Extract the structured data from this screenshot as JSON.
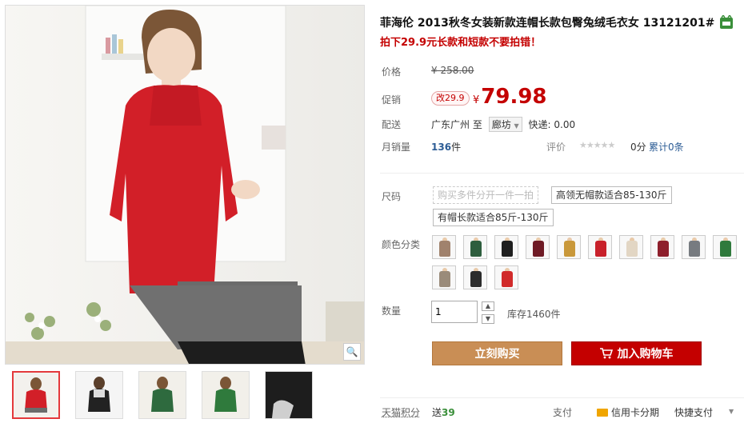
{
  "product": {
    "title": "菲海伦 2013秋冬女装新款连帽长款包臀兔绒毛衣女 13121201#",
    "promo": "拍下29.9元长款和短款不要拍错！"
  },
  "price": {
    "original_label": "价格",
    "original": "¥ 258.00",
    "promo_label": "促销",
    "badge": "改29.9",
    "currency": "¥",
    "current": "79.98"
  },
  "shipping": {
    "label": "配送",
    "from": "广东广州",
    "to_word": "至",
    "destination": "廊坊",
    "fee": "快递: 0.00"
  },
  "sales": {
    "label": "月销量",
    "count": "136",
    "unit": "件",
    "rating_label": "评价",
    "stars": "★★★★★",
    "score": "0分",
    "reviews": "累计0条"
  },
  "size": {
    "label": "尺码",
    "options": [
      "购买多件分开一件一拍",
      "高领无帽款适合85-130斤",
      "有帽长款适合85斤-130斤"
    ]
  },
  "color": {
    "label": "颜色分类",
    "swatches": [
      {
        "name": "camel",
        "color": "#a0826d"
      },
      {
        "name": "dark-green",
        "color": "#2e5e3e"
      },
      {
        "name": "black",
        "color": "#1f1f1f"
      },
      {
        "name": "wine",
        "color": "#6e1a25"
      },
      {
        "name": "mustard",
        "color": "#c9983a"
      },
      {
        "name": "red",
        "color": "#c8202a"
      },
      {
        "name": "beige",
        "color": "#e2d6c4"
      },
      {
        "name": "maroon",
        "color": "#8e1f2c"
      },
      {
        "name": "grey",
        "color": "#777b80"
      },
      {
        "name": "green",
        "color": "#2f7a3c"
      },
      {
        "name": "taupe",
        "color": "#9a8b7a"
      },
      {
        "name": "black-grey",
        "color": "#2c2c2c"
      },
      {
        "name": "red-grey",
        "color": "#d12a2a"
      }
    ]
  },
  "quantity": {
    "label": "数量",
    "value": "1",
    "stock": "库存1460件",
    "up": "▲",
    "down": "▼"
  },
  "actions": {
    "buy": "立刻购买",
    "cart": "加入购物车"
  },
  "footer": {
    "points_label": "天猫积分",
    "points_prefix": "送",
    "points_value": "39",
    "pay_label": "支付",
    "credit": "信用卡分期",
    "quick": "快捷支付",
    "more": "▼"
  },
  "gallery": {
    "zoom_icon": "🔍"
  },
  "colors": {
    "accent": "#c40000",
    "buy": "#c98e55",
    "link": "#2c5c95"
  }
}
